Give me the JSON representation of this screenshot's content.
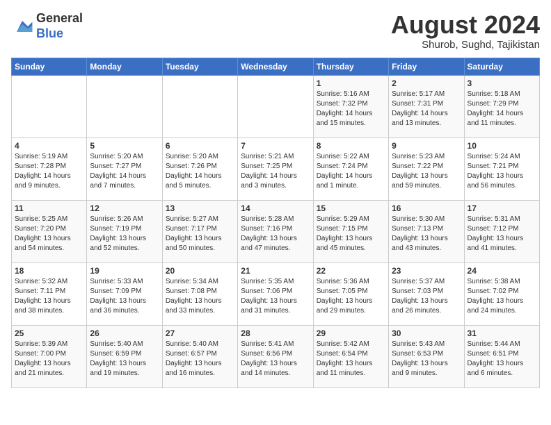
{
  "header": {
    "logo_line1": "General",
    "logo_line2": "Blue",
    "month_year": "August 2024",
    "location": "Shurob, Sughd, Tajikistan"
  },
  "days_of_week": [
    "Sunday",
    "Monday",
    "Tuesday",
    "Wednesday",
    "Thursday",
    "Friday",
    "Saturday"
  ],
  "weeks": [
    [
      {
        "day": "",
        "info": ""
      },
      {
        "day": "",
        "info": ""
      },
      {
        "day": "",
        "info": ""
      },
      {
        "day": "",
        "info": ""
      },
      {
        "day": "1",
        "info": "Sunrise: 5:16 AM\nSunset: 7:32 PM\nDaylight: 14 hours\nand 15 minutes."
      },
      {
        "day": "2",
        "info": "Sunrise: 5:17 AM\nSunset: 7:31 PM\nDaylight: 14 hours\nand 13 minutes."
      },
      {
        "day": "3",
        "info": "Sunrise: 5:18 AM\nSunset: 7:29 PM\nDaylight: 14 hours\nand 11 minutes."
      }
    ],
    [
      {
        "day": "4",
        "info": "Sunrise: 5:19 AM\nSunset: 7:28 PM\nDaylight: 14 hours\nand 9 minutes."
      },
      {
        "day": "5",
        "info": "Sunrise: 5:20 AM\nSunset: 7:27 PM\nDaylight: 14 hours\nand 7 minutes."
      },
      {
        "day": "6",
        "info": "Sunrise: 5:20 AM\nSunset: 7:26 PM\nDaylight: 14 hours\nand 5 minutes."
      },
      {
        "day": "7",
        "info": "Sunrise: 5:21 AM\nSunset: 7:25 PM\nDaylight: 14 hours\nand 3 minutes."
      },
      {
        "day": "8",
        "info": "Sunrise: 5:22 AM\nSunset: 7:24 PM\nDaylight: 14 hours\nand 1 minute."
      },
      {
        "day": "9",
        "info": "Sunrise: 5:23 AM\nSunset: 7:22 PM\nDaylight: 13 hours\nand 59 minutes."
      },
      {
        "day": "10",
        "info": "Sunrise: 5:24 AM\nSunset: 7:21 PM\nDaylight: 13 hours\nand 56 minutes."
      }
    ],
    [
      {
        "day": "11",
        "info": "Sunrise: 5:25 AM\nSunset: 7:20 PM\nDaylight: 13 hours\nand 54 minutes."
      },
      {
        "day": "12",
        "info": "Sunrise: 5:26 AM\nSunset: 7:19 PM\nDaylight: 13 hours\nand 52 minutes."
      },
      {
        "day": "13",
        "info": "Sunrise: 5:27 AM\nSunset: 7:17 PM\nDaylight: 13 hours\nand 50 minutes."
      },
      {
        "day": "14",
        "info": "Sunrise: 5:28 AM\nSunset: 7:16 PM\nDaylight: 13 hours\nand 47 minutes."
      },
      {
        "day": "15",
        "info": "Sunrise: 5:29 AM\nSunset: 7:15 PM\nDaylight: 13 hours\nand 45 minutes."
      },
      {
        "day": "16",
        "info": "Sunrise: 5:30 AM\nSunset: 7:13 PM\nDaylight: 13 hours\nand 43 minutes."
      },
      {
        "day": "17",
        "info": "Sunrise: 5:31 AM\nSunset: 7:12 PM\nDaylight: 13 hours\nand 41 minutes."
      }
    ],
    [
      {
        "day": "18",
        "info": "Sunrise: 5:32 AM\nSunset: 7:11 PM\nDaylight: 13 hours\nand 38 minutes."
      },
      {
        "day": "19",
        "info": "Sunrise: 5:33 AM\nSunset: 7:09 PM\nDaylight: 13 hours\nand 36 minutes."
      },
      {
        "day": "20",
        "info": "Sunrise: 5:34 AM\nSunset: 7:08 PM\nDaylight: 13 hours\nand 33 minutes."
      },
      {
        "day": "21",
        "info": "Sunrise: 5:35 AM\nSunset: 7:06 PM\nDaylight: 13 hours\nand 31 minutes."
      },
      {
        "day": "22",
        "info": "Sunrise: 5:36 AM\nSunset: 7:05 PM\nDaylight: 13 hours\nand 29 minutes."
      },
      {
        "day": "23",
        "info": "Sunrise: 5:37 AM\nSunset: 7:03 PM\nDaylight: 13 hours\nand 26 minutes."
      },
      {
        "day": "24",
        "info": "Sunrise: 5:38 AM\nSunset: 7:02 PM\nDaylight: 13 hours\nand 24 minutes."
      }
    ],
    [
      {
        "day": "25",
        "info": "Sunrise: 5:39 AM\nSunset: 7:00 PM\nDaylight: 13 hours\nand 21 minutes."
      },
      {
        "day": "26",
        "info": "Sunrise: 5:40 AM\nSunset: 6:59 PM\nDaylight: 13 hours\nand 19 minutes."
      },
      {
        "day": "27",
        "info": "Sunrise: 5:40 AM\nSunset: 6:57 PM\nDaylight: 13 hours\nand 16 minutes."
      },
      {
        "day": "28",
        "info": "Sunrise: 5:41 AM\nSunset: 6:56 PM\nDaylight: 13 hours\nand 14 minutes."
      },
      {
        "day": "29",
        "info": "Sunrise: 5:42 AM\nSunset: 6:54 PM\nDaylight: 13 hours\nand 11 minutes."
      },
      {
        "day": "30",
        "info": "Sunrise: 5:43 AM\nSunset: 6:53 PM\nDaylight: 13 hours\nand 9 minutes."
      },
      {
        "day": "31",
        "info": "Sunrise: 5:44 AM\nSunset: 6:51 PM\nDaylight: 13 hours\nand 6 minutes."
      }
    ]
  ]
}
